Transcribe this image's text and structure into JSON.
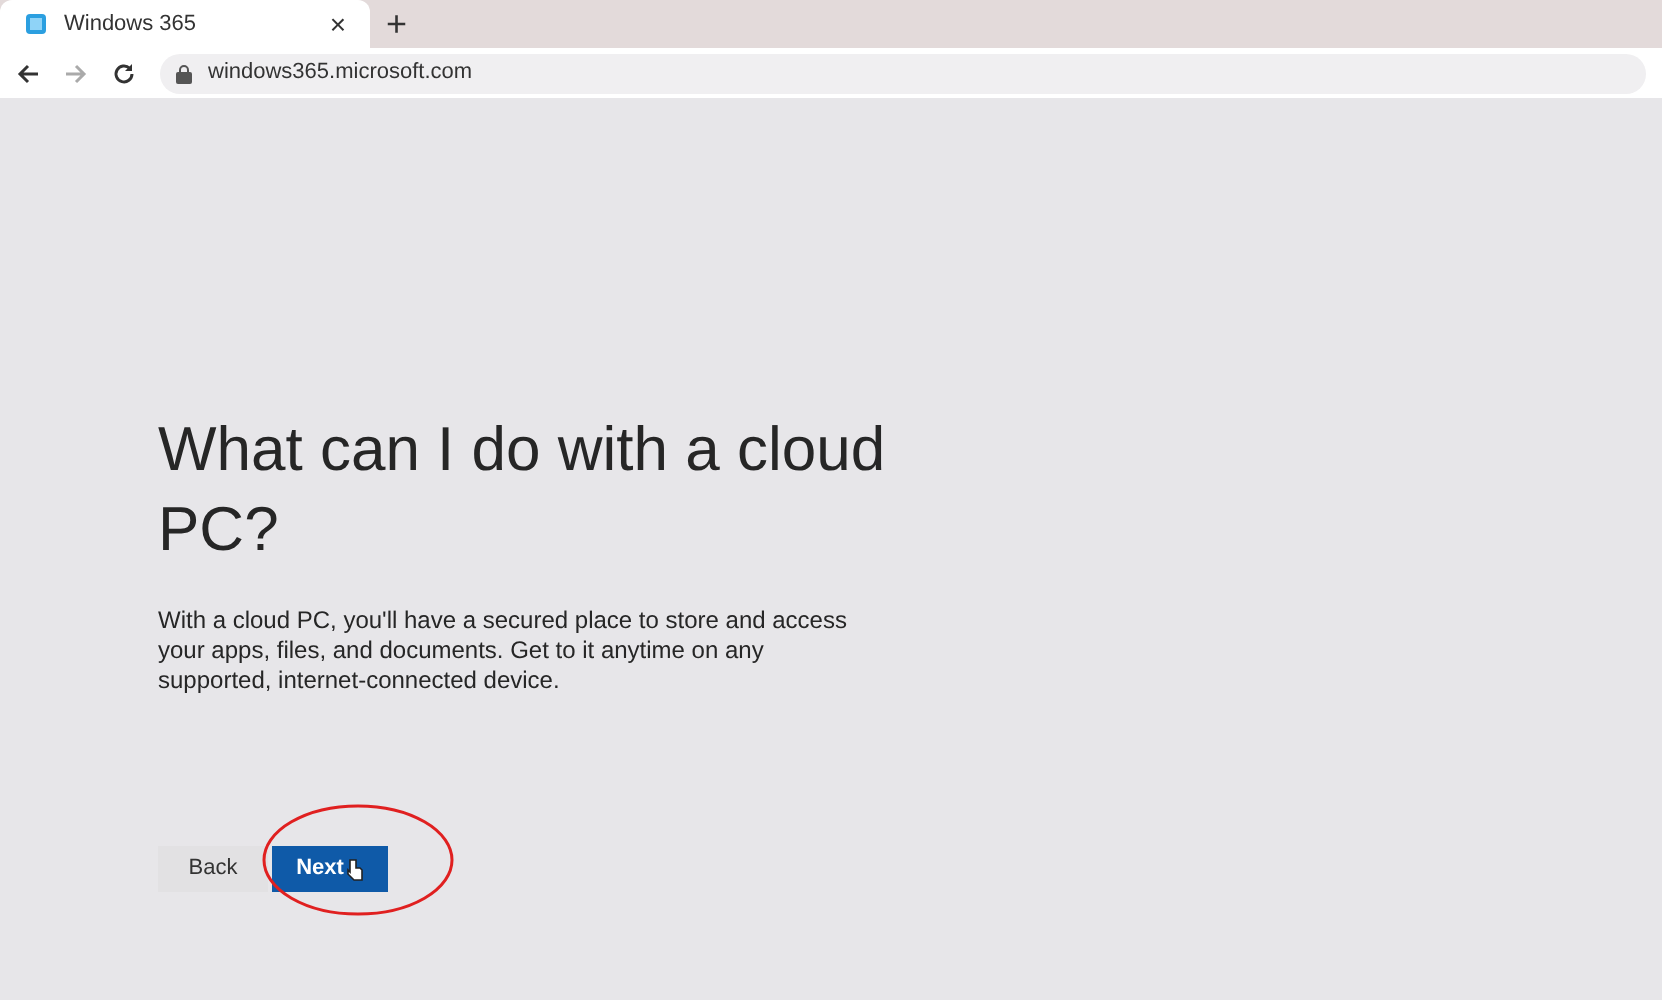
{
  "browser": {
    "tab": {
      "title": "Windows 365",
      "close": "×"
    },
    "new_tab": "+",
    "url": "windows365.microsoft.com"
  },
  "page": {
    "heading": "What can I do with a cloud PC?",
    "body": "With a cloud PC, you'll have a secured place to store and access your apps, files, and documents. Get to it anytime on any supported, internet-connected device.",
    "buttons": [
      {
        "label": "Back",
        "kind": "secondary"
      },
      {
        "label": "Next",
        "kind": "primary",
        "highlighted": true
      }
    ]
  }
}
